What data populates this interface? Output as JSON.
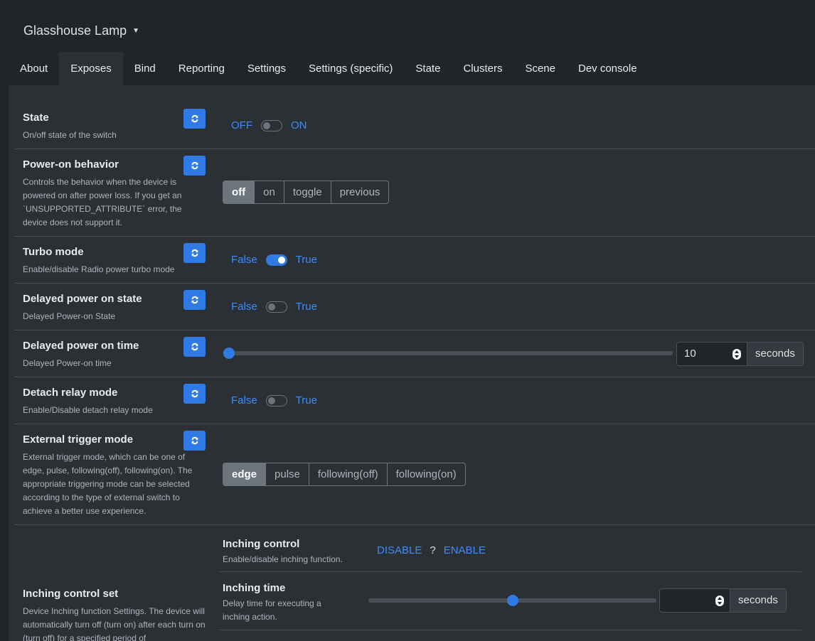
{
  "header": {
    "title": "Glasshouse Lamp",
    "caret_icon": "chevron-down-icon"
  },
  "tabs": [
    {
      "label": "About"
    },
    {
      "label": "Exposes",
      "active": true
    },
    {
      "label": "Bind"
    },
    {
      "label": "Reporting"
    },
    {
      "label": "Settings"
    },
    {
      "label": "Settings (specific)"
    },
    {
      "label": "State"
    },
    {
      "label": "Clusters"
    },
    {
      "label": "Scene"
    },
    {
      "label": "Dev console"
    }
  ],
  "colors": {
    "accent": "#2f7ae5",
    "link": "#3d8bfd",
    "background": "#212529",
    "panel": "#2b3035"
  },
  "exposes": {
    "state": {
      "name": "State",
      "desc": "On/off state of the switch",
      "off": "OFF",
      "on": "ON",
      "value": false
    },
    "power_on_behavior": {
      "name": "Power-on behavior",
      "desc": "Controls the behavior when the device is powered on after power loss. If you get an `UNSUPPORTED_ATTRIBUTE` error, the device does not support it.",
      "options": [
        "off",
        "on",
        "toggle",
        "previous"
      ],
      "selected": "off"
    },
    "turbo_mode": {
      "name": "Turbo mode",
      "desc": "Enable/disable Radio power turbo mode",
      "off": "False",
      "on": "True",
      "value": true
    },
    "delayed_power_on_state": {
      "name": "Delayed power on state",
      "desc": "Delayed Power-on State",
      "off": "False",
      "on": "True",
      "value": false
    },
    "delayed_power_on_time": {
      "name": "Delayed power on time",
      "desc": "Delayed Power-on time",
      "value": "10",
      "unit": "seconds",
      "slider_fraction": 0.0
    },
    "detach_relay_mode": {
      "name": "Detach relay mode",
      "desc": "Enable/Disable detach relay mode",
      "off": "False",
      "on": "True",
      "value": false
    },
    "external_trigger_mode": {
      "name": "External trigger mode",
      "desc": "External trigger mode, which can be one of edge, pulse, following(off), following(on). The appropriate triggering mode can be selected according to the type of external switch to achieve a better use experience.",
      "options": [
        "edge",
        "pulse",
        "following(off)",
        "following(on)"
      ],
      "selected": "edge"
    },
    "inching_control_set": {
      "name": "Inching control set",
      "desc": "Device Inching function Settings. The device will automatically turn off (turn on) after each turn on (turn off) for a specified period of",
      "inching_control": {
        "name": "Inching control",
        "desc": "Enable/disable inching function.",
        "disable": "DISABLE",
        "unknown": "?",
        "enable": "ENABLE"
      },
      "inching_time": {
        "name": "Inching time",
        "desc": "Delay time for executing a inching action.",
        "value": "",
        "unit": "seconds",
        "slider_fraction": 0.5
      }
    }
  },
  "icons": {
    "refresh": "refresh-icon"
  }
}
